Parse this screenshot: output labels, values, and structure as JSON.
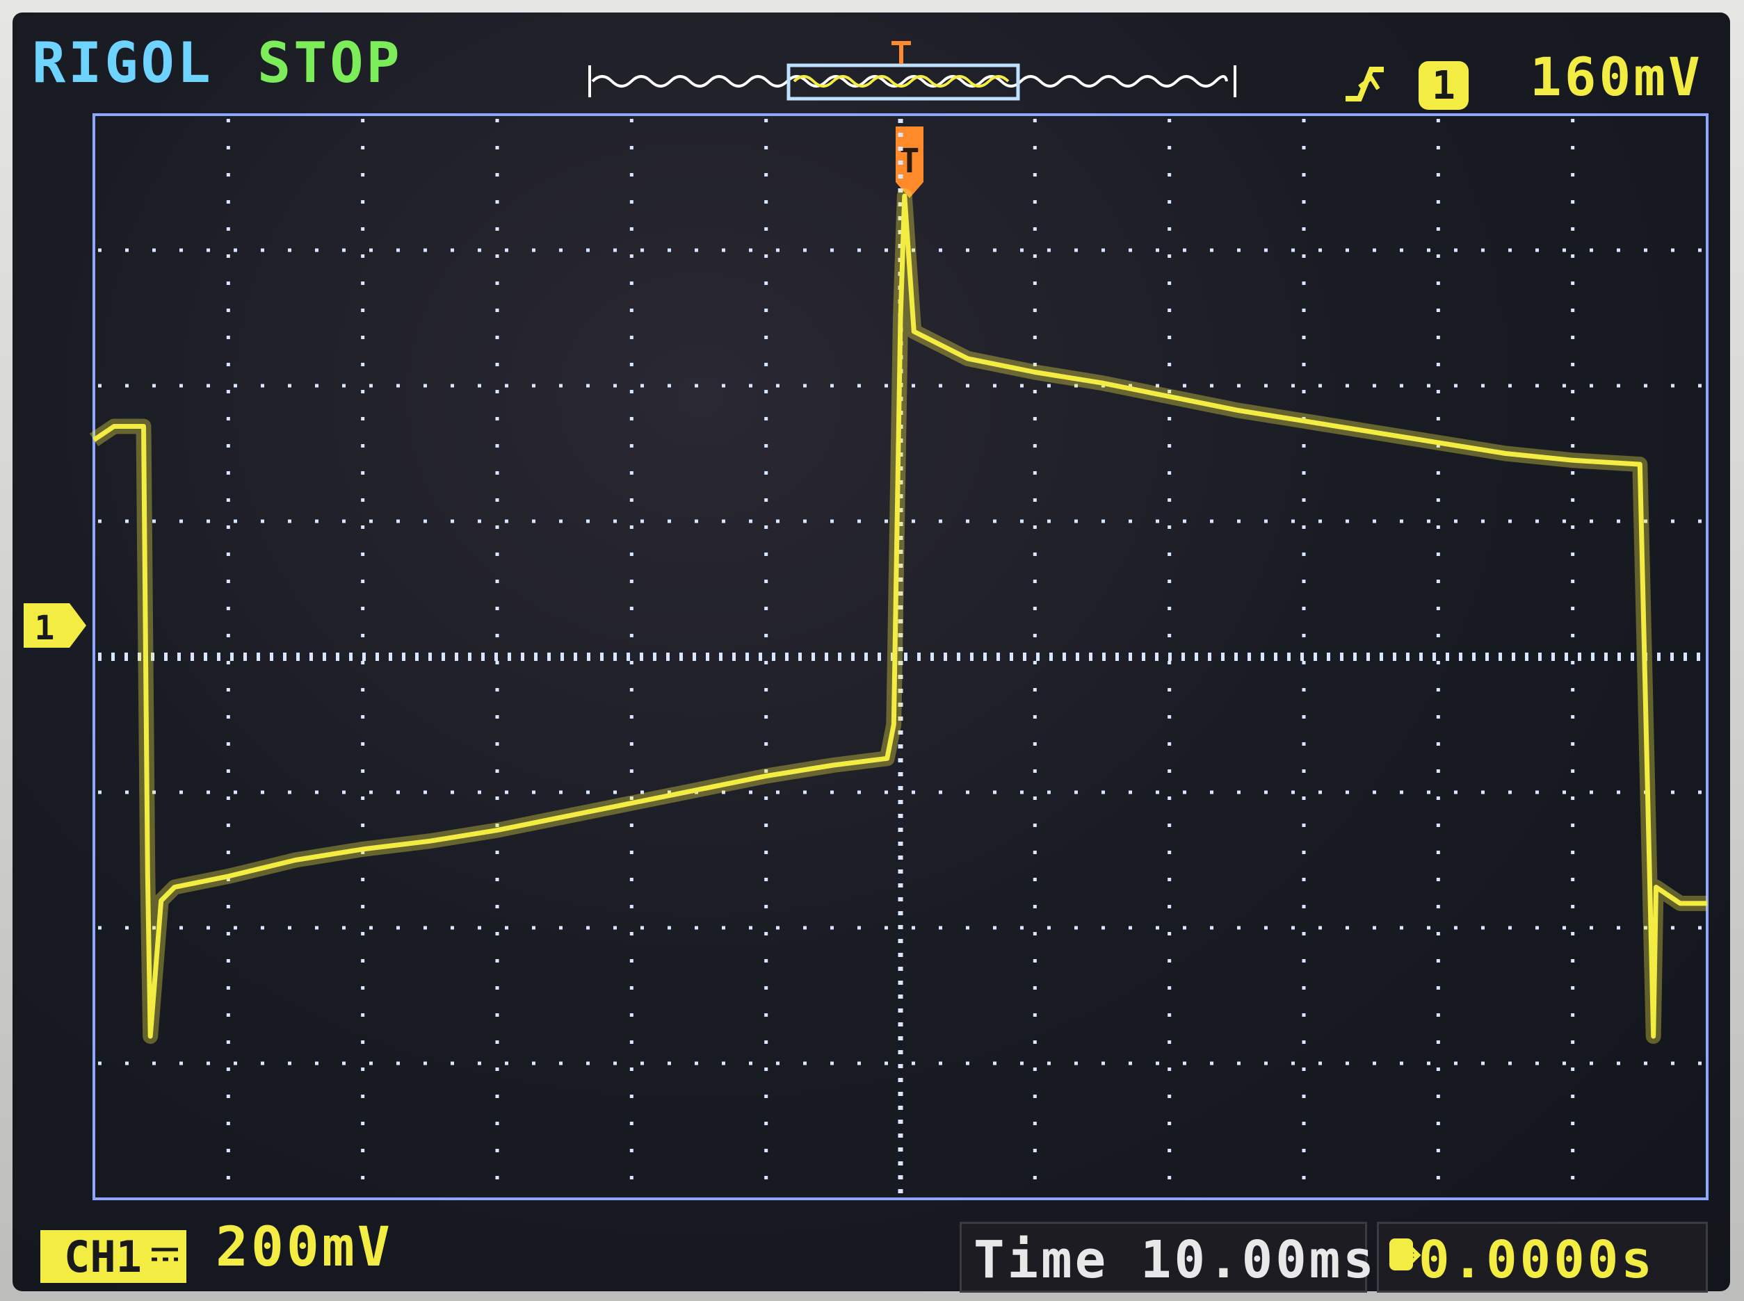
{
  "header": {
    "brand": "RIGOL",
    "run_state": "STOP",
    "trigger_slope_icon": "rising-edge-icon",
    "trigger_source": "1",
    "trigger_level": "160mV"
  },
  "channel": {
    "label": "CH1",
    "marker": "1",
    "scale": "200mV"
  },
  "timebase": {
    "label": "Time",
    "value": "10.00ms",
    "trigger_marker": "T",
    "offset": "0.0000s"
  },
  "colors": {
    "trace": "#f3ec43",
    "grid": "#d8e6ff",
    "brand": "#6fd3ff",
    "run_state": "#7dec5a",
    "trigger_marker": "#ff8a2a",
    "time_text": "#e8e8e8"
  },
  "grid": {
    "horizontal_divisions": 12,
    "vertical_divisions": 8
  },
  "chart_data": {
    "type": "line",
    "title": "",
    "xlabel": "",
    "ylabel": "",
    "x_unit": "div",
    "y_unit": "div",
    "xlim": [
      -6,
      6
    ],
    "ylim": [
      -4,
      4
    ],
    "series": [
      {
        "values": [
          [
            -6.0,
            1.6
          ],
          [
            -5.85,
            1.7
          ],
          [
            -5.7,
            1.7
          ],
          [
            -5.63,
            1.7
          ],
          [
            -5.6,
            -1.6
          ],
          [
            -5.58,
            -2.8
          ],
          [
            -5.5,
            -1.8
          ],
          [
            -5.4,
            -1.7
          ],
          [
            -5.0,
            -1.62
          ],
          [
            -4.5,
            -1.5
          ],
          [
            -4.0,
            -1.42
          ],
          [
            -3.5,
            -1.36
          ],
          [
            -3.0,
            -1.28
          ],
          [
            -2.5,
            -1.18
          ],
          [
            -2.0,
            -1.08
          ],
          [
            -1.5,
            -0.98
          ],
          [
            -1.0,
            -0.88
          ],
          [
            -0.5,
            -0.8
          ],
          [
            -0.1,
            -0.75
          ],
          [
            -0.05,
            -0.5
          ],
          [
            0.0,
            2.5
          ],
          [
            0.03,
            3.4
          ],
          [
            0.1,
            2.4
          ],
          [
            0.5,
            2.2
          ],
          [
            1.0,
            2.1
          ],
          [
            1.5,
            2.02
          ],
          [
            2.0,
            1.92
          ],
          [
            2.5,
            1.82
          ],
          [
            3.0,
            1.74
          ],
          [
            3.5,
            1.66
          ],
          [
            4.0,
            1.58
          ],
          [
            4.5,
            1.5
          ],
          [
            5.0,
            1.45
          ],
          [
            5.5,
            1.42
          ],
          [
            5.6,
            -2.8
          ],
          [
            5.62,
            -1.7
          ],
          [
            5.8,
            -1.82
          ],
          [
            6.0,
            -1.82
          ]
        ]
      }
    ]
  }
}
